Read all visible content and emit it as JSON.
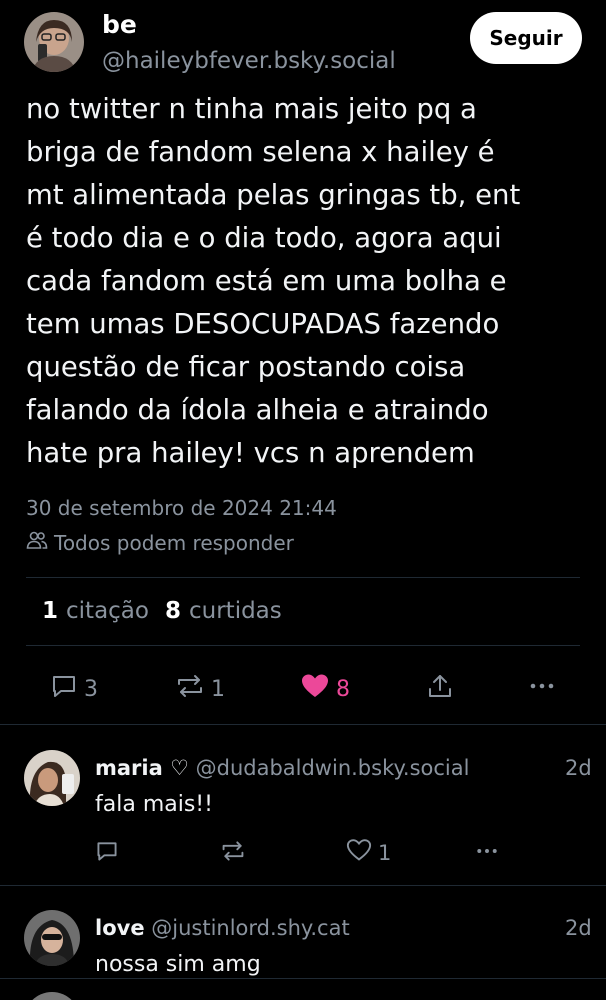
{
  "post": {
    "author_name": "be",
    "author_handle": "@haileybfever.bsky.social",
    "follow_label": "Seguir",
    "text": "no twitter n tinha mais jeito pq a\nbriga de fandom selena x hailey é\nmt alimentada pelas gringas tb, ent\né todo dia e o dia todo, agora aqui\ncada fandom está em uma bolha e\ntem umas DESOCUPADAS fazendo\nquestão de ficar postando coisa\nfalando da ídola alheia e atraindo\nhate pra hailey! vcs n aprendem",
    "date": "30 de setembro de 2024 21:44",
    "reply_setting": "Todos podem responder",
    "quotes_count": "1",
    "quotes_label": "citação",
    "likes_count": "8",
    "likes_label": "curtidas",
    "actions": {
      "reply_count": "3",
      "repost_count": "1",
      "like_count": "8"
    }
  },
  "replies": [
    {
      "name": "maria ♡",
      "handle": "@dudabaldwin.bsky.social",
      "time": "2d",
      "text": "fala mais!!",
      "reply_count": "",
      "repost_count": "",
      "like_count": "1"
    },
    {
      "name": "love",
      "handle": "@justinlord.shy.cat",
      "time": "2d",
      "text": "nossa sim amg"
    }
  ],
  "colors": {
    "background": "#000000",
    "muted": "#8a939e",
    "like_pink": "#ec4899",
    "separator": "#1f2933"
  }
}
